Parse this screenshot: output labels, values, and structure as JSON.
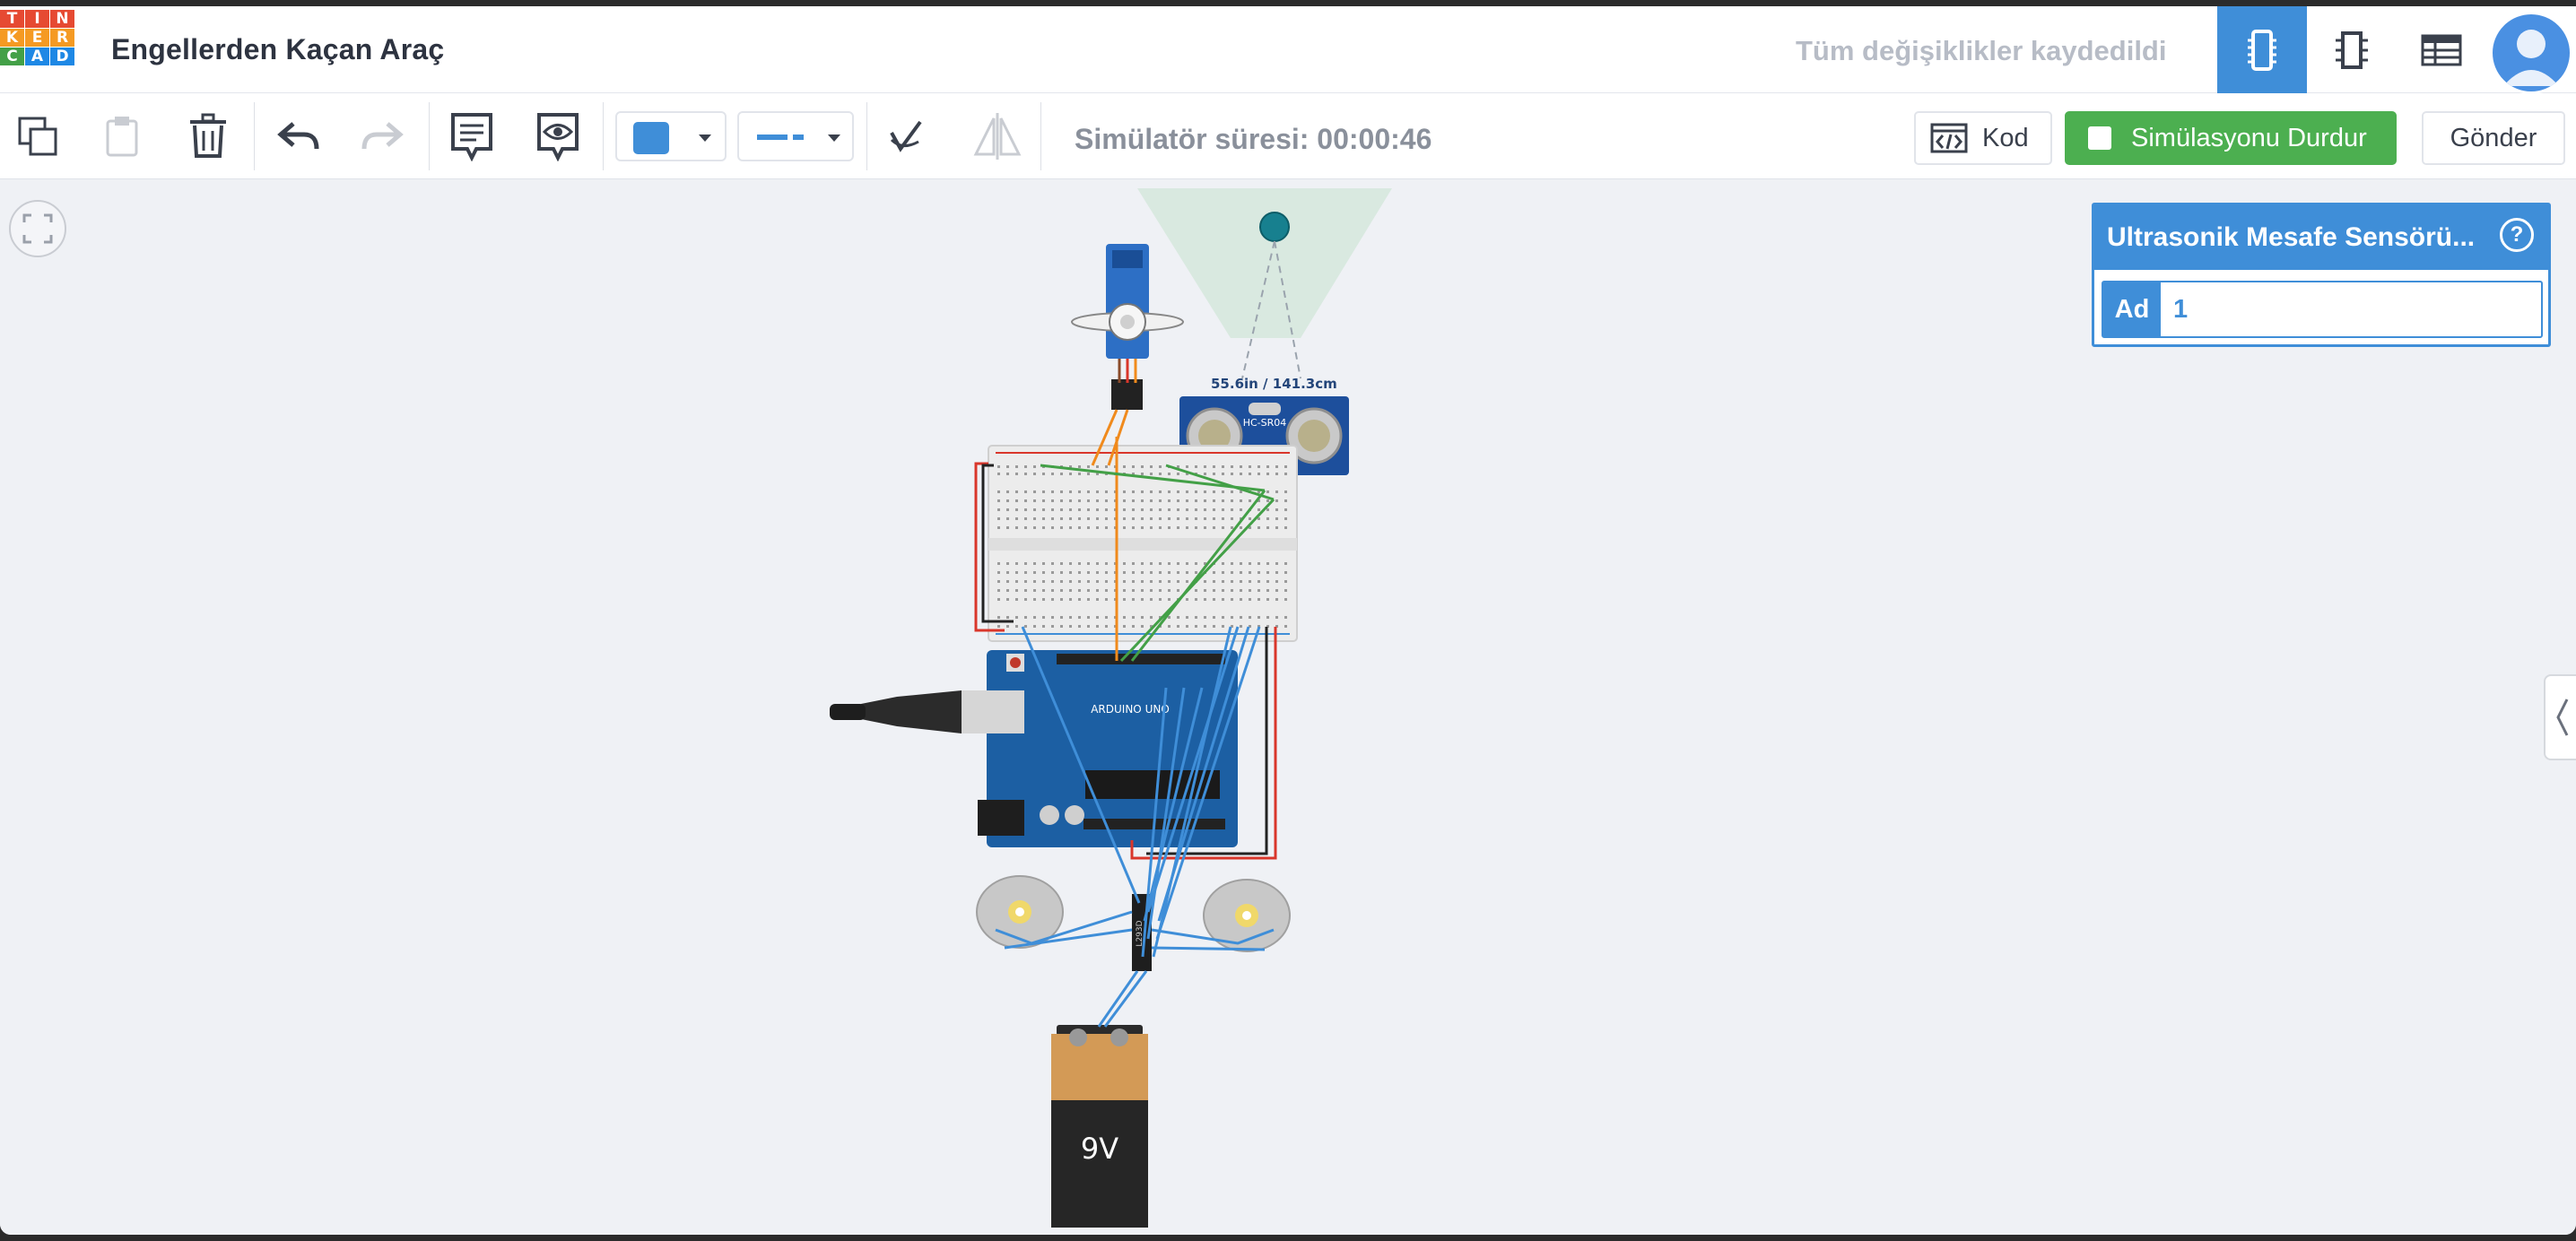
{
  "app": {
    "logo_letters": [
      "T",
      "I",
      "N",
      "K",
      "E",
      "R",
      "C",
      "A",
      "D"
    ],
    "logo_colors": [
      "#e64a32",
      "#e64a32",
      "#e64a32",
      "#f59a23",
      "#f59a23",
      "#f59a23",
      "#43a047",
      "#1e88e5",
      "#1e88e5"
    ],
    "document_title": "Engellerden Kaçan Araç",
    "save_status": "Tüm değişiklikler kaydedildi",
    "views": [
      {
        "name": "circuit-view-icon",
        "active": true
      },
      {
        "name": "schematic-view-icon",
        "active": false
      },
      {
        "name": "component-list-icon",
        "active": false
      }
    ],
    "accent_color": "#3f8ed8"
  },
  "toolbar": {
    "copy_icon": "copy-icon",
    "paste_icon": "paste-icon",
    "delete_icon": "trash-icon",
    "undo_icon": "undo-icon",
    "redo_icon": "redo-icon",
    "note_icon": "note-icon",
    "visibility_icon": "eye-icon",
    "wire_color": "#3f8ed8",
    "line_style_icon": "line-style-icon",
    "rotate_icon": "rotate-icon",
    "flip_icon": "flip-icon",
    "simulator_time": "Simülatör süresi: 00:00:46",
    "code_button": "Kod",
    "stop_button": "Simülasyonu Durdur",
    "send_button": "Gönder",
    "stop_button_color": "#4caf50"
  },
  "canvas": {
    "fit_icon": "fit-to-view-icon",
    "side_handle_icon": "chevron-left-icon",
    "sensor_readout": "55.6in / 141.3cm",
    "sensor_label": "HC-SR04",
    "battery_label": "9V",
    "board_label": "ARDUINO UNO",
    "driver_label": "L293D"
  },
  "inspector": {
    "title": "Ultrasonik Mesafe Sensörü...",
    "help": "?",
    "property_key": "Ad",
    "property_value": "1"
  }
}
